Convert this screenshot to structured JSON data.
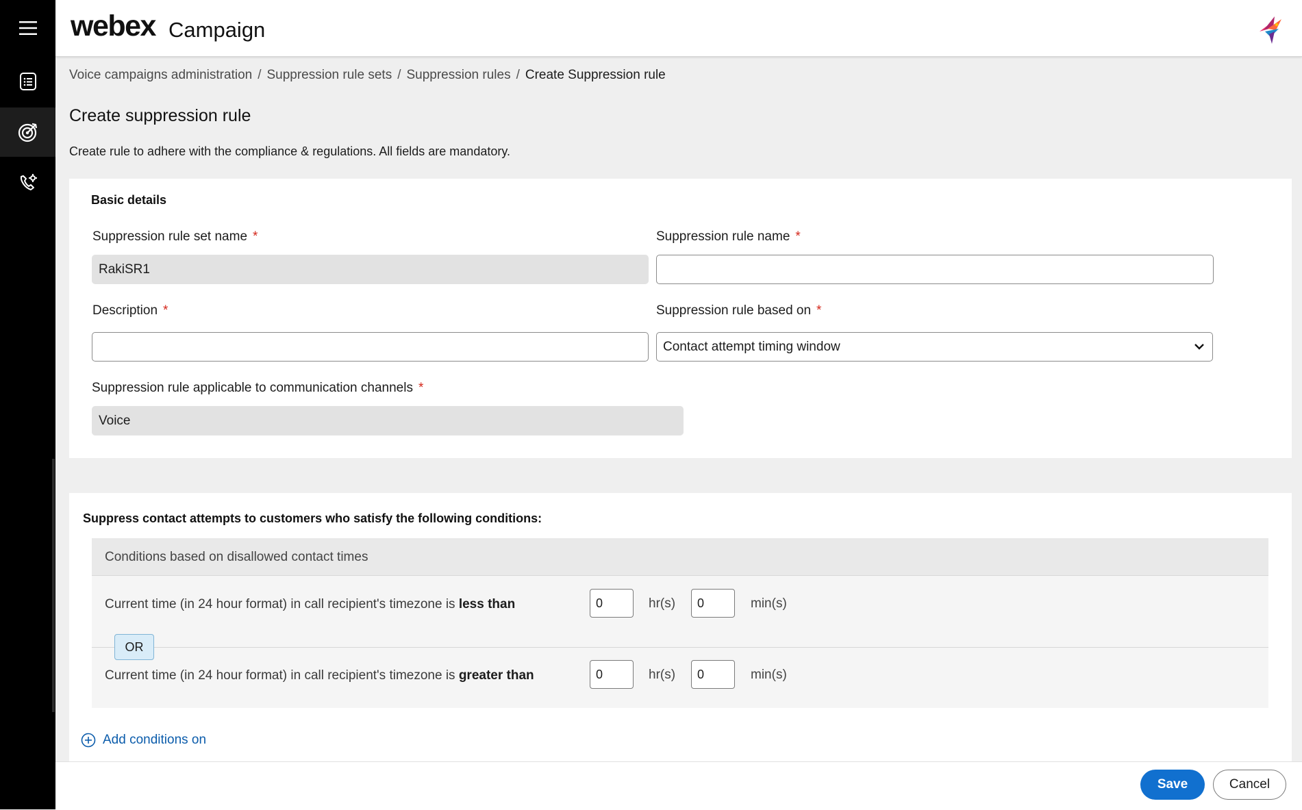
{
  "header": {
    "logo_word": "webex",
    "product": "Campaign"
  },
  "sidebar": {
    "items": [
      {
        "icon": "hamburger-menu-icon"
      },
      {
        "icon": "list-document-icon"
      },
      {
        "icon": "target-icon",
        "active": true
      },
      {
        "icon": "phone-settings-icon"
      }
    ]
  },
  "breadcrumb": {
    "items": [
      "Voice campaigns administration",
      "Suppression rule sets",
      "Suppression rules",
      "Create Suppression rule"
    ],
    "separator": "/"
  },
  "page": {
    "title": "Create suppression rule",
    "subtitle": "Create rule to adhere with the compliance & regulations. All fields are mandatory."
  },
  "basic_details": {
    "heading": "Basic details",
    "rule_set_name_label": "Suppression rule set name",
    "rule_set_name_value": "RakiSR1",
    "rule_name_label": "Suppression rule name",
    "rule_name_value": "",
    "description_label": "Description",
    "description_value": "",
    "based_on_label": "Suppression rule based on",
    "based_on_value": "Contact attempt timing window",
    "channels_label": "Suppression rule applicable to communication channels",
    "channels_value": "Voice",
    "required_marker": "*"
  },
  "conditions": {
    "heading": "Suppress contact attempts to customers who satisfy the following conditions:",
    "panel_title": "Conditions based on disallowed contact times",
    "row1_prefix": "Current time (in 24 hour format) in call recipient's timezone is",
    "row1_operator": "less than",
    "row1_hours": "0",
    "row1_minutes": "0",
    "row2_prefix": "Current time (in 24 hour format) in call recipient's timezone is",
    "row2_operator": "greater than",
    "row2_hours": "0",
    "row2_minutes": "0",
    "hours_unit": "hr(s)",
    "minutes_unit": "min(s)",
    "or_label": "OR",
    "add_conditions_label": "Add conditions on"
  },
  "footer": {
    "save_label": "Save",
    "cancel_label": "Cancel"
  },
  "colors": {
    "primary": "#1170cf",
    "link": "#0b5cab",
    "required": "#d4271b",
    "sidebar_bg": "#000000"
  }
}
